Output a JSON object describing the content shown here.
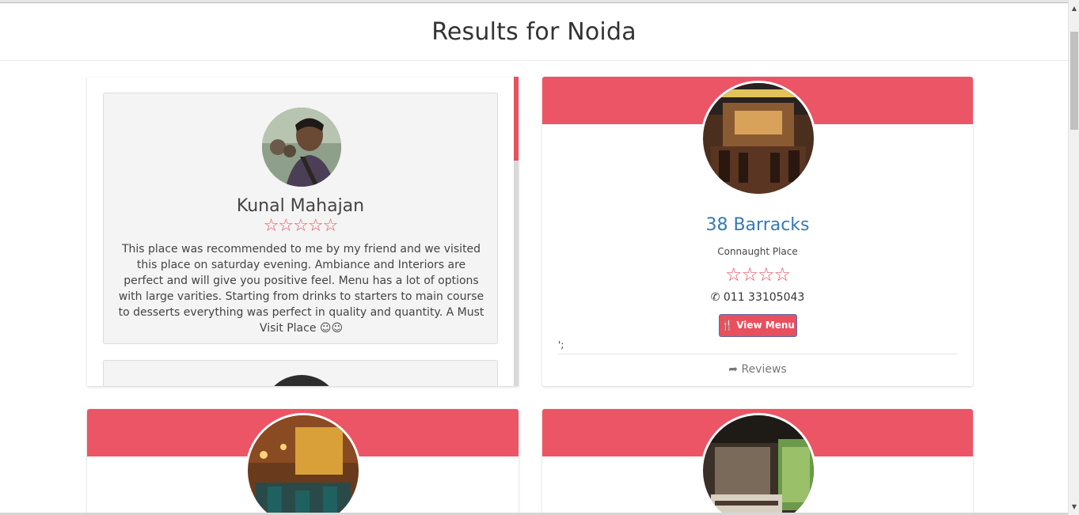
{
  "page": {
    "title": "Results for Noida"
  },
  "review": {
    "name": "Kunal Mahajan",
    "stars": "☆☆☆☆☆",
    "text": "This place was recommended to me by my friend and we visited this place on saturday evening. Ambiance and Interiors are perfect and will give you positive feel. Menu has a lot of options with large varities. Starting from drinks to starters to main course to desserts everything was perfect in quality and quantity. A Must Visit Place ☺☺",
    "rating": 5
  },
  "restaurant": {
    "name": "38 Barracks",
    "location": "Connaught Place",
    "stars": "☆☆☆☆",
    "rating": 4,
    "phone": "011 33105043",
    "menu_button": "View Menu",
    "stray_text": "';",
    "reviews_link": "Reviews"
  },
  "colors": {
    "accent": "#ec5566",
    "link": "#337ab7"
  },
  "icons": {
    "phone": "phone-icon",
    "menu": "cutlery-icon",
    "share": "share-icon"
  }
}
